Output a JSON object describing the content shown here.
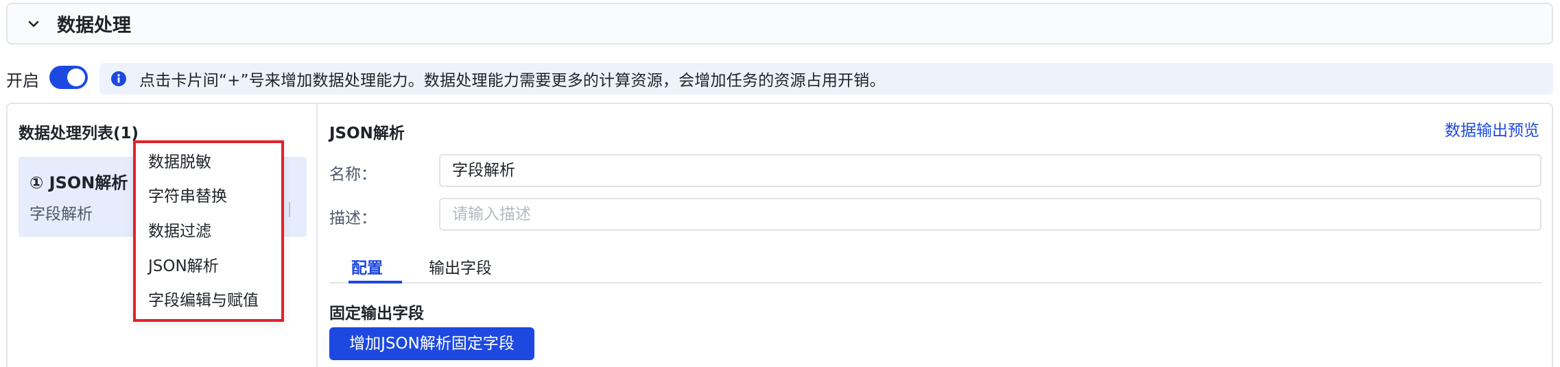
{
  "section": {
    "title": "数据处理"
  },
  "toggle": {
    "label": "开启",
    "on": true
  },
  "info": {
    "text": "点击卡片间“+”号来增加数据处理能力。数据处理能力需要更多的计算资源，会增加任务的资源占用开销。"
  },
  "list": {
    "title": "数据处理列表(1)",
    "items": [
      {
        "title": "① JSON解析",
        "subtitle": "字段解析"
      }
    ]
  },
  "dropdown": {
    "items": [
      "数据脱敏",
      "字符串替换",
      "数据过滤",
      "JSON解析",
      "字段编辑与赋值"
    ]
  },
  "detail": {
    "title": "JSON解析",
    "preview_link": "数据输出预览",
    "name_label": "名称：",
    "name_value": "字段解析",
    "desc_label": "描述：",
    "desc_placeholder": "请输入描述",
    "tabs": [
      {
        "label": "配置",
        "active": true
      },
      {
        "label": "输出字段",
        "active": false
      }
    ],
    "fixed_title": "固定输出字段",
    "add_button": "增加JSON解析固定字段"
  },
  "colors": {
    "accent": "#1d49e0",
    "highlight_border": "#e5202b",
    "info_bg": "#eef2fb",
    "selected_card_bg": "#e6ecfc"
  },
  "icons": {
    "section_toggle": "chevron-down-icon",
    "info": "info-icon"
  }
}
